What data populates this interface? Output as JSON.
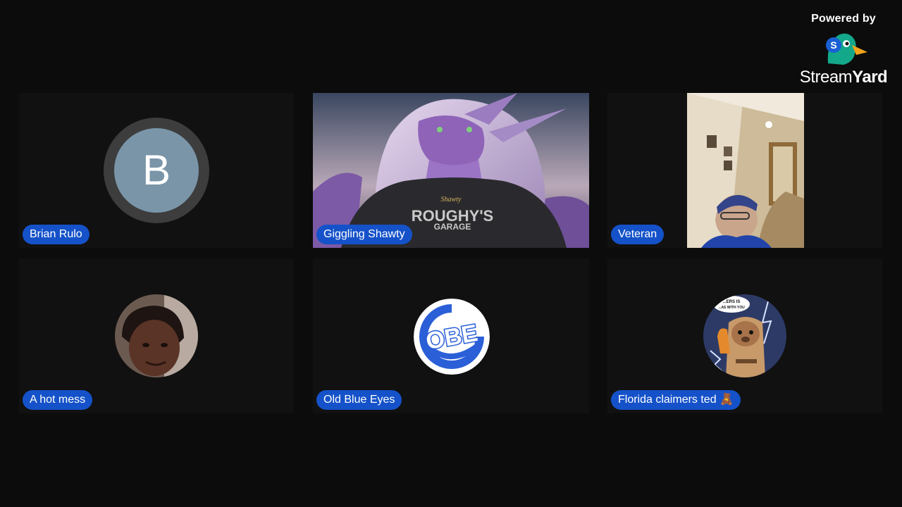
{
  "branding": {
    "powered_by": "Powered by",
    "logo_icon": "streamyard-duck-icon",
    "wordmark_light": "Stream",
    "wordmark_bold": "Yard"
  },
  "participants": [
    {
      "name": "Brian Rulo",
      "avatar_letter": "B",
      "media": "letter-avatar"
    },
    {
      "name": "Giggling Shawty",
      "media": "video",
      "shirt_text_1": "ROUGHY'S",
      "shirt_text_2": "GARAGE",
      "necklace_text": "Shawty"
    },
    {
      "name": "Veteran",
      "media": "video"
    },
    {
      "name": "A hot mess",
      "media": "photo-avatar"
    },
    {
      "name": "Old Blue Eyes",
      "media": "logo-avatar",
      "logo_text": "OBE"
    },
    {
      "name": "Florida claimers ted 🧸",
      "media": "photo-avatar",
      "bubble_text_1": "...ERS IS",
      "bubble_text_2": "...AS WITH YOU"
    }
  ],
  "colors": {
    "background": "#0c0c0c",
    "tile": "#111111",
    "name_tag": "#1552c9"
  }
}
